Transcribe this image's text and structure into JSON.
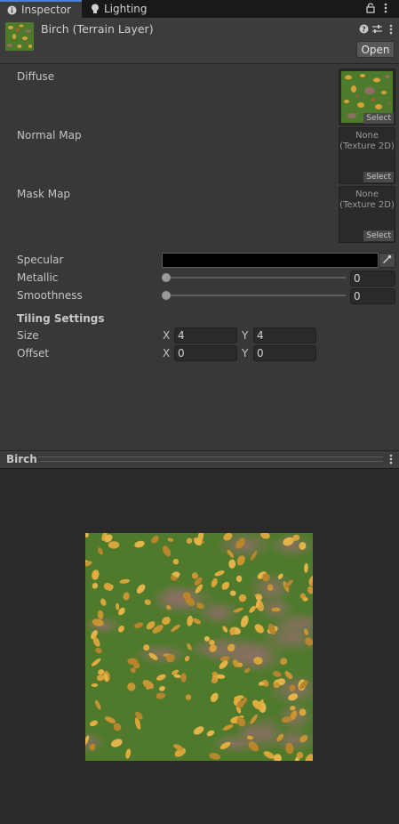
{
  "tabs": [
    {
      "label": "Inspector",
      "icon": "info-icon",
      "active": true
    },
    {
      "label": "Lighting",
      "icon": "lightbulb-icon",
      "active": false
    }
  ],
  "header": {
    "title": "Birch (Terrain Layer)",
    "open_label": "Open"
  },
  "textures": {
    "diffuse": {
      "label": "Diffuse",
      "select": "Select"
    },
    "normal": {
      "label": "Normal Map",
      "none_line1": "None",
      "none_line2": "(Texture 2D)",
      "select": "Select"
    },
    "mask": {
      "label": "Mask Map",
      "none_line1": "None",
      "none_line2": "(Texture 2D)",
      "select": "Select"
    }
  },
  "props": {
    "specular": {
      "label": "Specular",
      "color": "#000000"
    },
    "metallic": {
      "label": "Metallic",
      "value": "0"
    },
    "smoothness": {
      "label": "Smoothness",
      "value": "0"
    }
  },
  "tiling": {
    "title": "Tiling Settings",
    "size": {
      "label": "Size",
      "x_label": "X",
      "x": "4",
      "y_label": "Y",
      "y": "4"
    },
    "offset": {
      "label": "Offset",
      "x_label": "X",
      "x": "0",
      "y_label": "Y",
      "y": "0"
    }
  },
  "preview": {
    "title": "Birch"
  },
  "colors": {
    "accent": "#4b7fd1",
    "grass": "#4f7a2c",
    "leaf": "#d9a53a",
    "dirt": "#8a6f63"
  }
}
